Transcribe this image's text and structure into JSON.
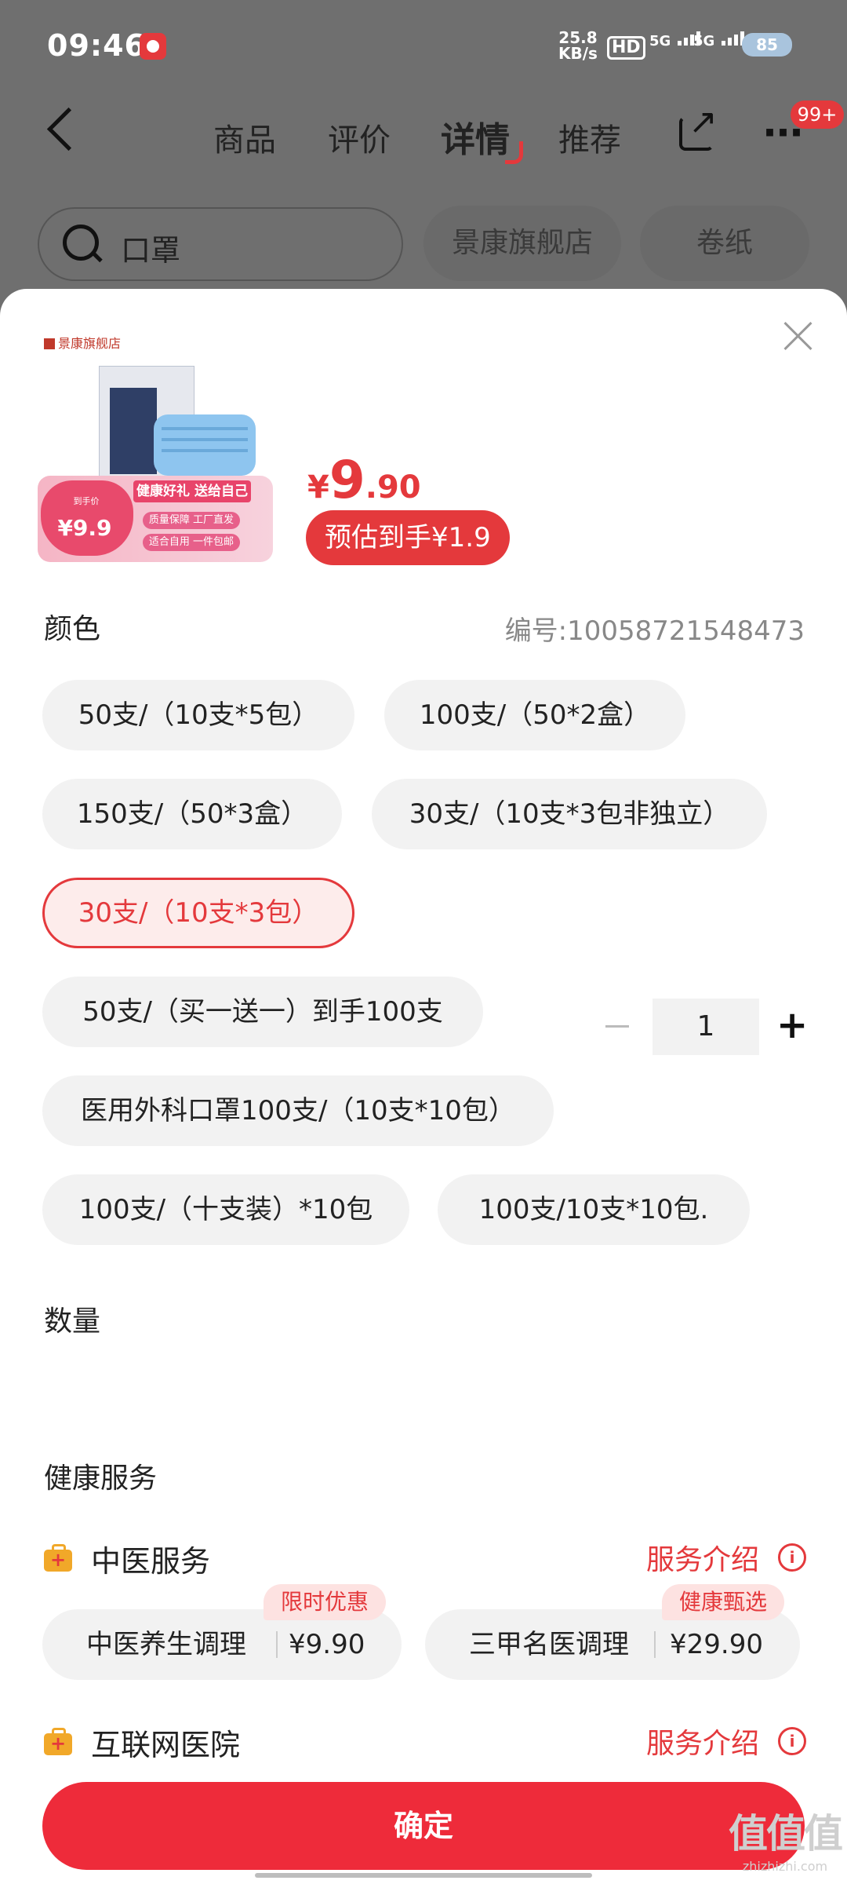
{
  "status": {
    "time": "09:46",
    "net_speed": "25.8",
    "net_unit": "KB/s",
    "hd": "HD",
    "sim1": "5G",
    "sim2": "5G",
    "battery": "85"
  },
  "nav": {
    "tabs": [
      "商品",
      "评价",
      "详情",
      "推荐"
    ],
    "active_tab": "详情",
    "more_badge": "99+"
  },
  "search": {
    "query": "口罩",
    "chips": [
      "景康旗舰店",
      "卷纸"
    ]
  },
  "product": {
    "store": "景康旗舰店",
    "image_price_label": "到手价",
    "image_price": "¥9.9",
    "image_ribbon": "健康好礼 送给自己",
    "image_tags": [
      "质量保障 工厂直发",
      "适合自用 一件包邮"
    ],
    "price_yen": "¥",
    "price_int": "9",
    "price_dec": ".90",
    "estimate": "预估到手¥1.9"
  },
  "spec": {
    "label": "颜色",
    "sku_number": "编号:10058721548473",
    "options": [
      "50支/（10支*5包）",
      "100支/（50*2盒）",
      "150支/（50*3盒）",
      "30支/（10支*3包非独立）",
      "30支/（10支*3包）",
      "50支/（买一送一）到手100支",
      "医用外科口罩100支/（10支*10包）",
      "100支/（十支装）*10包",
      "100支/10支*10包."
    ],
    "selected": "30支/（10支*3包）"
  },
  "quantity": {
    "label": "数量",
    "value": "1",
    "minus": "−",
    "plus": "+"
  },
  "health": {
    "title": "健康服务",
    "services": [
      {
        "name": "中医服务",
        "link": "服务介绍",
        "options": [
          {
            "name": "中医养生调理",
            "price": "¥9.90",
            "tag": "限时优惠"
          },
          {
            "name": "三甲名医调理",
            "price": "¥29.90",
            "tag": "健康甄选"
          }
        ]
      },
      {
        "name": "互联网医院",
        "link": "服务介绍"
      }
    ]
  },
  "confirm_label": "确定",
  "watermark": {
    "logo": "值值值",
    "site": "zhizhizhi.com"
  },
  "colors": {
    "accent": "#e4393c",
    "chip_bg": "#f2f2f2",
    "overlay": "#6f6f6f"
  },
  "icons": [
    "back-icon",
    "share-icon",
    "more-icon",
    "search-icon",
    "close-icon",
    "medical-kit-icon",
    "info-icon"
  ]
}
